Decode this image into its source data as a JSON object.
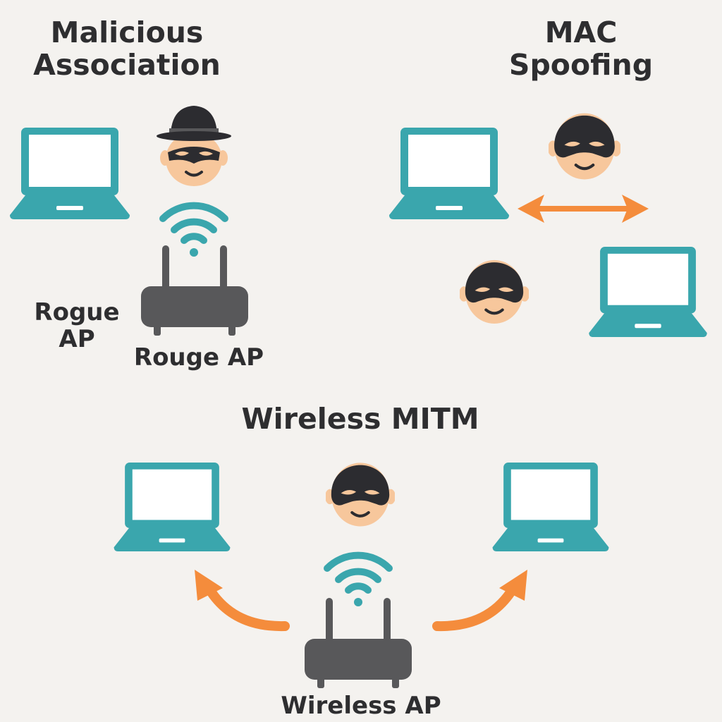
{
  "sections": {
    "malicious_association": {
      "title": [
        "Malicious",
        "Association"
      ],
      "side_label": [
        "Rogue",
        "AP"
      ],
      "router_label": "Rouge AP"
    },
    "mac_spoofing": {
      "title": [
        "MAC",
        "Spoofing"
      ]
    },
    "wireless_mitm": {
      "title": "Wireless MITM",
      "router_label": "Wireless AP"
    }
  },
  "colors": {
    "background": "#f4f2ef",
    "laptop": "#3aa6ad",
    "screen": "#ffffff",
    "wifi": "#3aa6ad",
    "router": "#58585a",
    "arrow": "#f48c3c",
    "skin": "#f7c79c",
    "mask": "#2c2c30",
    "text": "#2e2e30"
  },
  "icons": [
    "laptop-icon",
    "hacker-icon",
    "wifi-icon",
    "router-icon",
    "arrow-icon"
  ]
}
